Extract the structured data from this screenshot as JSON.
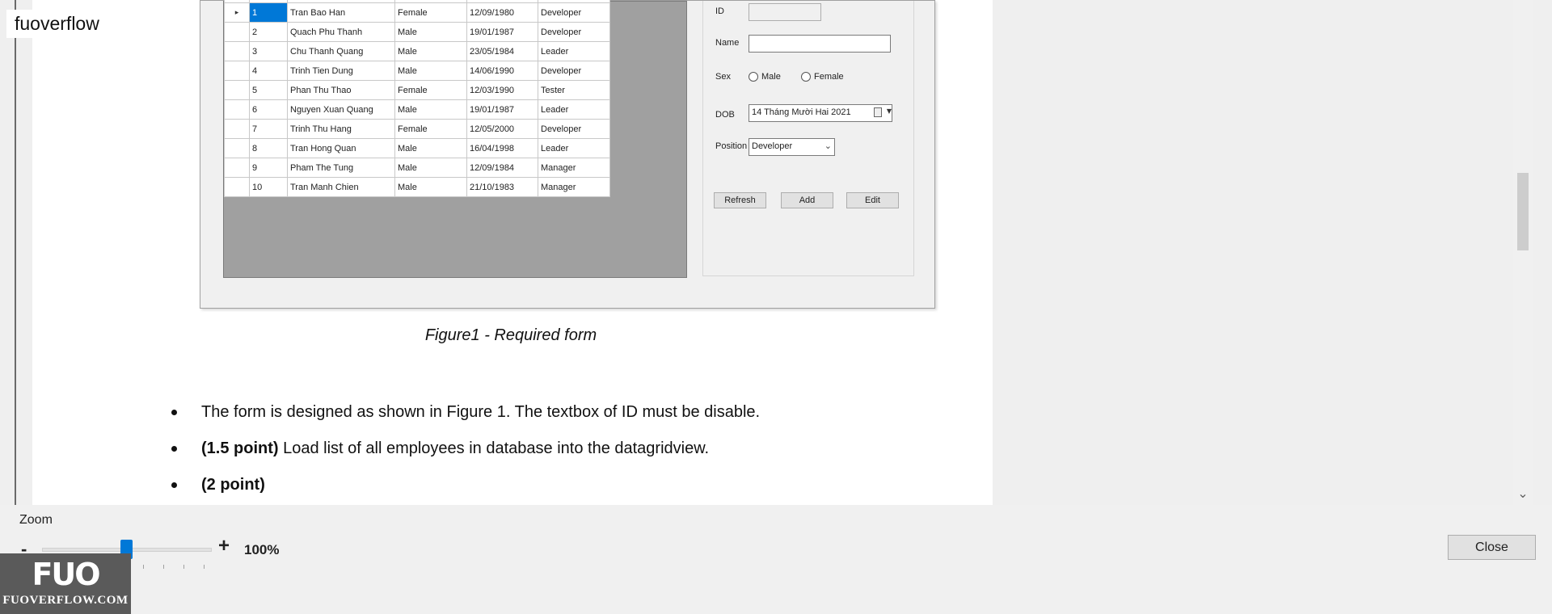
{
  "brand": {
    "top_label": "fuoverflow",
    "logo_mark": "FUO",
    "logo_text": "FUOVERFLOW.COM"
  },
  "figure": {
    "rows": [
      {
        "id": "1",
        "name": "Tran Bao Han",
        "sex": "Female",
        "dob": "12/09/1980",
        "position": "Developer"
      },
      {
        "id": "2",
        "name": "Quach Phu Thanh",
        "sex": "Male",
        "dob": "19/01/1987",
        "position": "Developer"
      },
      {
        "id": "3",
        "name": "Chu Thanh Quang",
        "sex": "Male",
        "dob": "23/05/1984",
        "position": "Leader"
      },
      {
        "id": "4",
        "name": "Trinh Tien Dung",
        "sex": "Male",
        "dob": "14/06/1990",
        "position": "Developer"
      },
      {
        "id": "5",
        "name": "Phan Thu Thao",
        "sex": "Female",
        "dob": "12/03/1990",
        "position": "Tester"
      },
      {
        "id": "6",
        "name": "Nguyen Xuan Quang",
        "sex": "Male",
        "dob": "19/01/1987",
        "position": "Leader"
      },
      {
        "id": "7",
        "name": "Trinh Thu Hang",
        "sex": "Female",
        "dob": "12/05/2000",
        "position": "Developer"
      },
      {
        "id": "8",
        "name": "Tran Hong Quan",
        "sex": "Male",
        "dob": "16/04/1998",
        "position": "Leader"
      },
      {
        "id": "9",
        "name": "Pham The Tung",
        "sex": "Male",
        "dob": "12/09/1984",
        "position": "Manager"
      },
      {
        "id": "10",
        "name": "Tran Manh Chien",
        "sex": "Male",
        "dob": "21/10/1983",
        "position": "Manager"
      }
    ],
    "selected_row_marker": "▸",
    "form": {
      "id_label": "ID",
      "name_label": "Name",
      "sex_label": "Sex",
      "male_label": "Male",
      "female_label": "Female",
      "dob_label": "DOB",
      "dob_value": "14 Tháng Mười Hai 2021",
      "position_label": "Position",
      "position_value": "Developer",
      "refresh_label": "Refresh",
      "add_label": "Add",
      "edit_label": "Edit"
    }
  },
  "caption": "Figure1 - Required form",
  "bullets": {
    "b1": "The form is designed as shown in Figure 1. The textbox of ID must be disable.",
    "b2_bold": "(1.5 point)",
    "b2_text": " Load list of all employees in database into the datagridview.",
    "b3_bold": "(2 point)"
  },
  "zoom": {
    "label": "Zoom",
    "minus": "-",
    "plus": "+",
    "value": "100%",
    "level_percent": 100
  },
  "close_label": "Close",
  "icons": {
    "scroll_down": "chevron-down-icon"
  }
}
